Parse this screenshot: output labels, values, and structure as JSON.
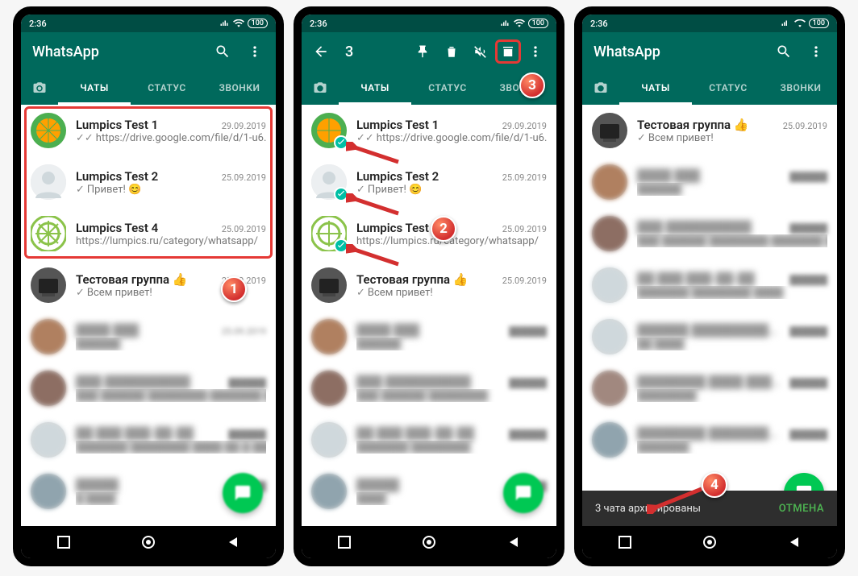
{
  "status": {
    "time": "2:36",
    "battery": "100"
  },
  "app": {
    "title": "WhatsApp"
  },
  "tabs": {
    "chats": "ЧАТЫ",
    "status": "СТАТУС",
    "calls": "ЗВОНКИ"
  },
  "selection": {
    "count": "3"
  },
  "snackbar": {
    "text": "3 чата архивированы",
    "action": "ОТМЕНА"
  },
  "steps": {
    "s1": "1",
    "s2": "2",
    "s3": "3",
    "s4": "4"
  },
  "chats_a": [
    {
      "name": "Lumpics Test 1",
      "date": "29.09.2019",
      "msg": "https://drive.google.com/file/d/1-u6...",
      "ticks": true
    },
    {
      "name": "Lumpics Test 2",
      "date": "25.09.2019",
      "msg": "Привет! 😊",
      "ticks": true
    },
    {
      "name": "Lumpics Test 4",
      "date": "25.09.2019",
      "msg": "https://lumpics.ru/category/whatsapp/",
      "ticks": false
    },
    {
      "name": "Тестовая группа 👍",
      "date": "25.09.2019",
      "msg": "Всем привет!",
      "ticks": true
    }
  ],
  "chats_c": [
    {
      "name": "Тестовая группа 👍",
      "date": "25.09.2019",
      "msg": "Всем привет!",
      "ticks": true
    }
  ],
  "blurred_date_1": "25.09.2019"
}
